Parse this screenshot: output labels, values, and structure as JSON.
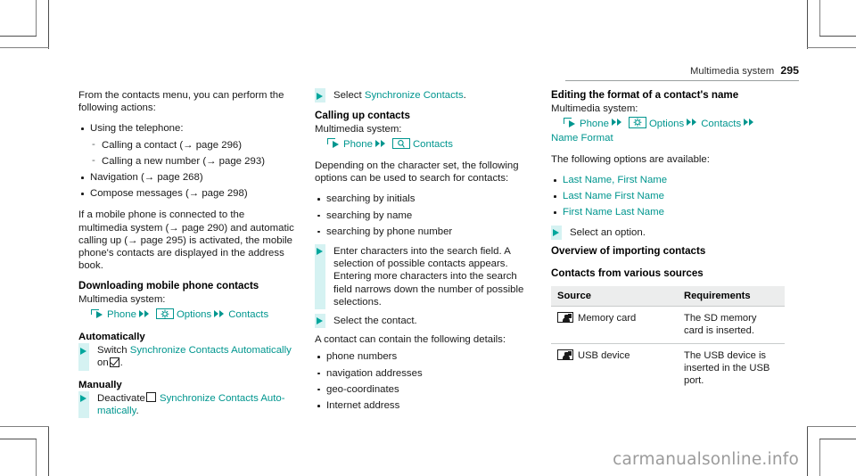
{
  "header": {
    "title": "Multimedia system",
    "page_number": "295"
  },
  "watermark": "carmanualsonline.info",
  "left_column": {
    "intro": "From the contacts menu, you can perform the following actions:",
    "actions": [
      "Using the telephone:",
      "Navigation (→ page 268)",
      "Compose messages (→ page 298)"
    ],
    "telephone_subitems": [
      "Calling a contact (→ page 296)",
      "Calling a new number (→ page 293)"
    ],
    "connected_note": "If a mobile phone is connected to the multimedia system (→ page 290) and automatic calling up (→ page 295) is activated, the mobile phone's contacts are displayed in the address book.",
    "download_heading": "Downloading mobile phone contacts",
    "download_system_label": "Multimedia system:",
    "download_path": {
      "step1": "Phone",
      "step2": "Options",
      "step3": "Contacts"
    },
    "automatically_heading": "Automatically",
    "automatically_step": {
      "pre": "Switch",
      "teal": "Synchronize Contacts Automatically",
      "mid": "on",
      "post": "."
    },
    "manually_heading": "Manually",
    "manually_step": {
      "pre": "Deactivate",
      "teal": "Synchronize Contacts Auto-matically",
      "post": "."
    }
  },
  "middle_column": {
    "select_step": {
      "pre": "Select",
      "teal": "Synchronize Contacts",
      "post": "."
    },
    "calling_heading": "Calling up contacts",
    "calling_system_label": "Multimedia system:",
    "calling_path": {
      "step1": "Phone",
      "step2": "Contacts"
    },
    "depending_note": "Depending on the character set, the following options can be used to search for contacts:",
    "search_options": [
      "searching by initials",
      "searching by name",
      "searching by phone number"
    ],
    "enter_step": "Enter characters into the search field. A selection of possible contacts appears. Entering more characters into the search field narrows down the number of possible selections.",
    "select_contact_step": "Select the contact.",
    "details_intro": "A contact can contain the following details:",
    "details": [
      "phone numbers",
      "navigation addresses",
      "geo-coordinates",
      "Internet address"
    ]
  },
  "right_column": {
    "editing_heading": "Editing the format of a contact's name",
    "editing_system_label": "Multimedia system:",
    "editing_path": {
      "step1": "Phone",
      "step2": "Options",
      "step3": "Contacts",
      "step4": "Name Format"
    },
    "options_intro": "The following options are available:",
    "name_format_options": [
      "Last Name, First Name",
      "Last Name First Name",
      "First Name Last Name"
    ],
    "select_option_step": "Select an option.",
    "overview_heading": "Overview of importing contacts",
    "sources_heading": "Contacts from various sources",
    "table": {
      "columns": [
        "Source",
        "Requirements"
      ],
      "rows": [
        {
          "source": "Memory card",
          "requirement": "The SD memory card is inserted."
        },
        {
          "source": "USB device",
          "requirement": "The USB device is inserted in the USB port."
        }
      ]
    }
  },
  "colors": {
    "teal": "#00968f",
    "teal_arrow": "#00a69c",
    "highlight": "#d5f2f2",
    "table_header_bg": "#eceded"
  }
}
